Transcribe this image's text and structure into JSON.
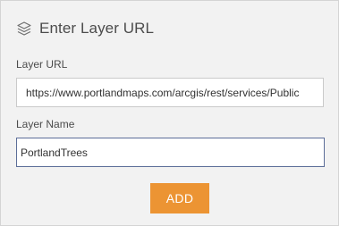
{
  "header": {
    "title": "Enter Layer URL",
    "icon": "layers-icon"
  },
  "layer_url": {
    "label": "Layer URL",
    "value": "https://www.portlandmaps.com/arcgis/rest/services/Public"
  },
  "layer_name": {
    "label": "Layer Name",
    "value": "PortlandTrees"
  },
  "add_button": {
    "label": "ADD",
    "color": "#ec9433"
  },
  "colors": {
    "panel_background": "#f2f2f2",
    "text": "#4c4c4c",
    "focused_border": "#5c6e99"
  }
}
